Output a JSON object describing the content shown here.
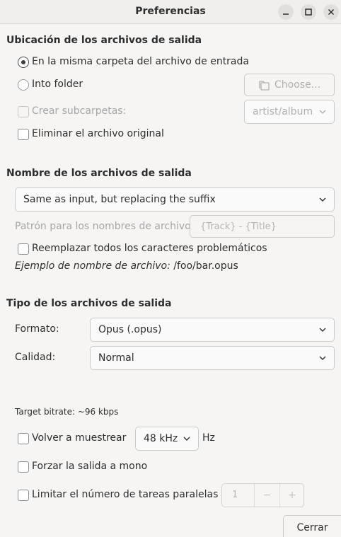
{
  "window": {
    "title": "Preferencias"
  },
  "output_location": {
    "heading": "Ubicación de los archivos de salida",
    "same_folder_label": "En la misma carpeta del archivo de entrada",
    "into_folder_label": "Into folder",
    "choose_button": "Choose...",
    "subfolders_label": "Crear subcarpetas:",
    "subfolders_value": "artist/album",
    "delete_original_label": "Eliminar el archivo original"
  },
  "output_names": {
    "heading": "Nombre de los archivos de salida",
    "naming_mode": "Same as input, but replacing the suffix",
    "pattern_label": "Patrón para los nombres de archivo:",
    "pattern_placeholder": "{Track} - {Title}",
    "replace_label": "Reemplazar todos los caracteres problemáticos",
    "example_label": "Ejemplo de nombre de archivo:",
    "example_value": "/foo/bar.opus"
  },
  "output_type": {
    "heading": "Tipo de los archivos de salida",
    "format_label": "Formato:",
    "format_value": "Opus (.opus)",
    "quality_label": "Calidad:",
    "quality_value": "Normal",
    "bitrate_text": "Target bitrate: ~96 kbps",
    "resample_label": "Volver a muestrear",
    "resample_rate": "48 kHz",
    "resample_unit": "Hz",
    "mono_label": "Forzar la salida a mono",
    "limit_jobs_label": "Limitar el número de tareas paralelas",
    "jobs_value": "1",
    "minus": "−",
    "plus": "+"
  },
  "footer": {
    "close_button": "Cerrar"
  },
  "colors": {
    "background": "#f6f5f4",
    "text": "#2e2e2e",
    "disabled_text": "#a6a6a6"
  }
}
